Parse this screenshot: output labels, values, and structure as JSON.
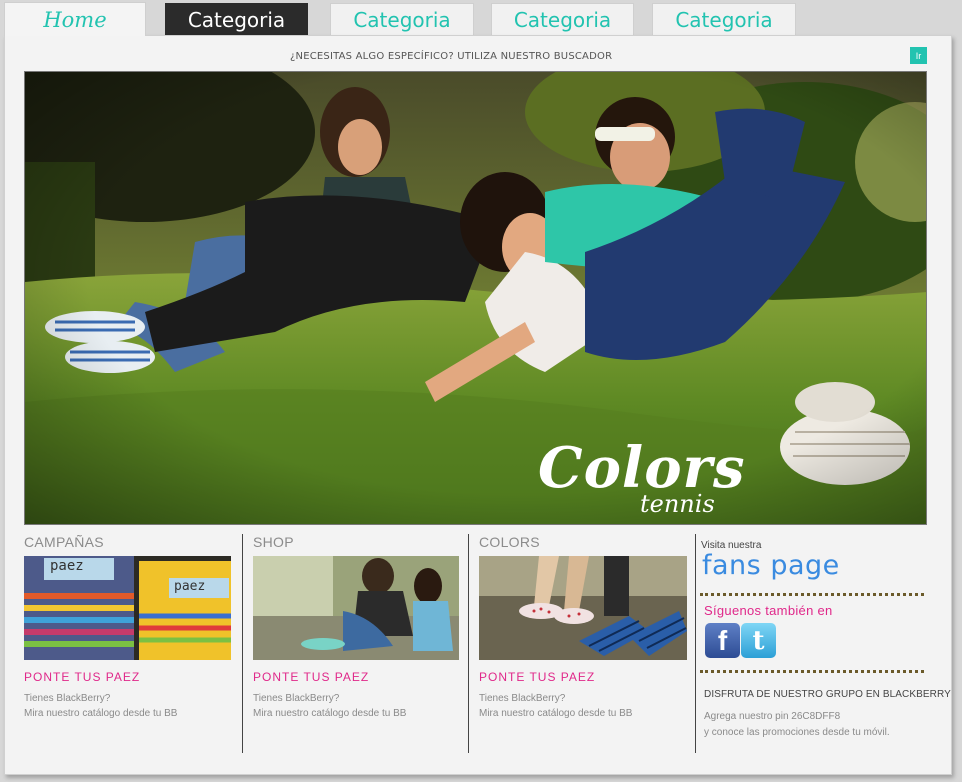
{
  "nav": {
    "tabs": [
      {
        "label": "Home"
      },
      {
        "label": "Categoria"
      },
      {
        "label": "Categoria"
      },
      {
        "label": "Categoria"
      },
      {
        "label": "Categoria"
      }
    ]
  },
  "search": {
    "prompt": "¿NECESITAS ALGO ESPECÍFICO? UTILIZA NUESTRO BUSCADOR",
    "button_label": "Ir"
  },
  "hero": {
    "logo_main": "Colors",
    "logo_sub": "tennis"
  },
  "columns": [
    {
      "title": "CAMPAÑAS",
      "link": "PONTE TUS PAEZ",
      "desc_line1": "Tienes BlackBerry?",
      "desc_line2": "Mira nuestro catálogo desde tu BB",
      "thumb_text": "paez"
    },
    {
      "title": "SHOP",
      "link": "PONTE TUS PAEZ",
      "desc_line1": "Tienes BlackBerry?",
      "desc_line2": "Mira nuestro catálogo desde tu BB"
    },
    {
      "title": "COLORS",
      "link": "PONTE TUS PAEZ",
      "desc_line1": "Tienes BlackBerry?",
      "desc_line2": "Mira nuestro catálogo desde tu BB"
    }
  ],
  "sidebar": {
    "visit_label": "Visita nuestra",
    "fans_link": "fans page",
    "follow_label": "Síguenos también en",
    "facebook_glyph": "f",
    "twitter_glyph": "t",
    "bb_title": "DISFRUTA DE NUESTRO GRUPO EN BLACKBERRY",
    "bb_desc_line1": "Agrega nuestro pin 26C8DFF8",
    "bb_desc_line2": "y conoce las promociones desde tu móvil."
  },
  "colors": {
    "accent_teal": "#22c3b0",
    "accent_pink": "#e0288a",
    "fans_blue": "#3a8be0"
  }
}
